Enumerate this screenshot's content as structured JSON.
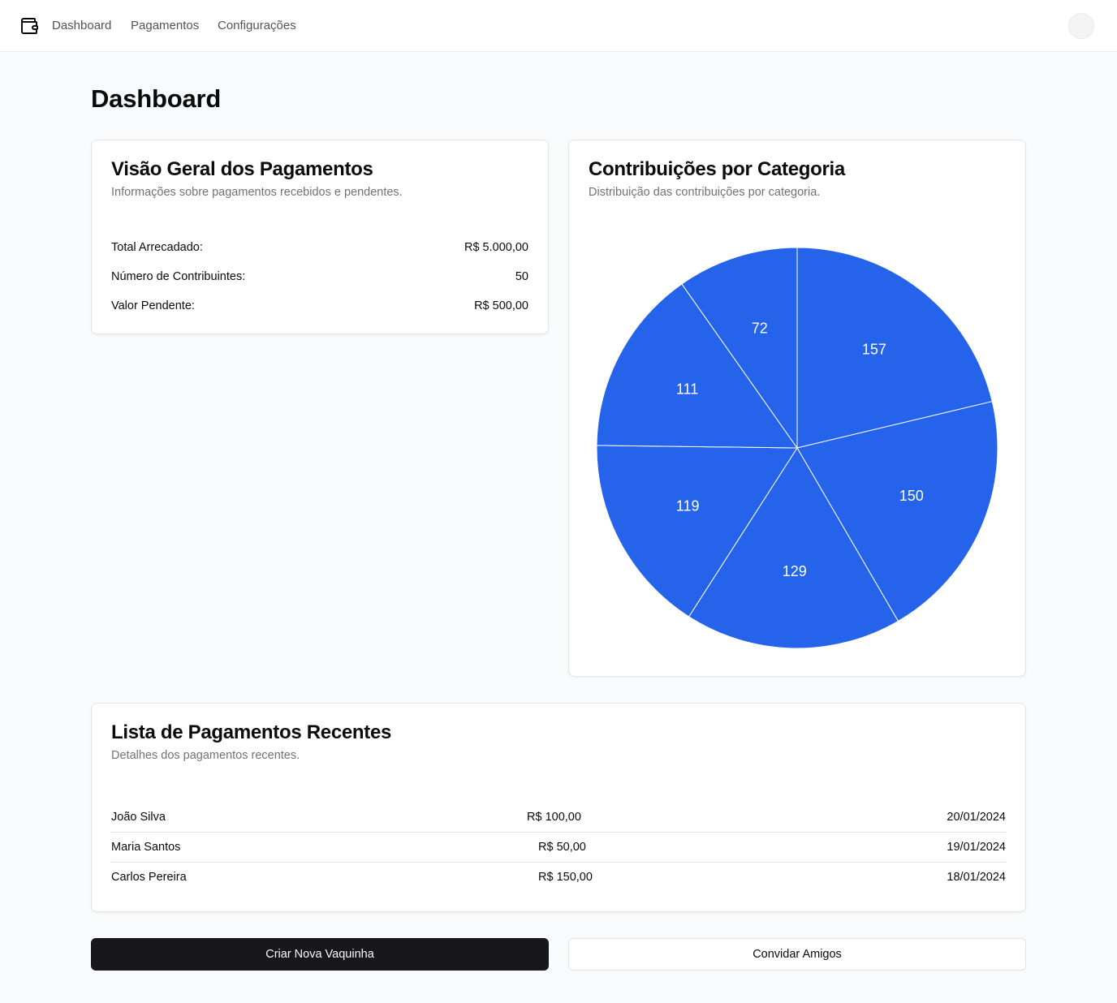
{
  "nav": {
    "links": [
      "Dashboard",
      "Pagamentos",
      "Configurações"
    ]
  },
  "page": {
    "title": "Dashboard"
  },
  "overview": {
    "title": "Visão Geral dos Pagamentos",
    "description": "Informações sobre pagamentos recebidos e pendentes.",
    "rows": [
      {
        "label": "Total Arrecadado:",
        "value": "R$ 5.000,00"
      },
      {
        "label": "Número de Contribuintes:",
        "value": "50"
      },
      {
        "label": "Valor Pendente:",
        "value": "R$ 500,00"
      }
    ]
  },
  "contributions": {
    "title": "Contribuições por Categoria",
    "description": "Distribuição das contribuições por categoria."
  },
  "chart_data": {
    "type": "pie",
    "title": "Contribuições por Categoria",
    "values": [
      157,
      150,
      129,
      119,
      111,
      72
    ],
    "color": "#2563eb",
    "start_angle": "top",
    "direction": "clockwise"
  },
  "recent": {
    "title": "Lista de Pagamentos Recentes",
    "description": "Detalhes dos pagamentos recentes.",
    "rows": [
      {
        "name": "João Silva",
        "amount": "R$ 100,00",
        "date": "20/01/2024"
      },
      {
        "name": "Maria Santos",
        "amount": "R$ 50,00",
        "date": "19/01/2024"
      },
      {
        "name": "Carlos Pereira",
        "amount": "R$ 150,00",
        "date": "18/01/2024"
      }
    ]
  },
  "actions": {
    "primary_label": "Criar Nova Vaquinha",
    "secondary_label": "Convidar Amigos"
  },
  "icons": {
    "logo": "wallet-icon",
    "avatar": "user-avatar"
  },
  "colors": {
    "accent": "#2563eb",
    "primary_button": "#18181b"
  }
}
